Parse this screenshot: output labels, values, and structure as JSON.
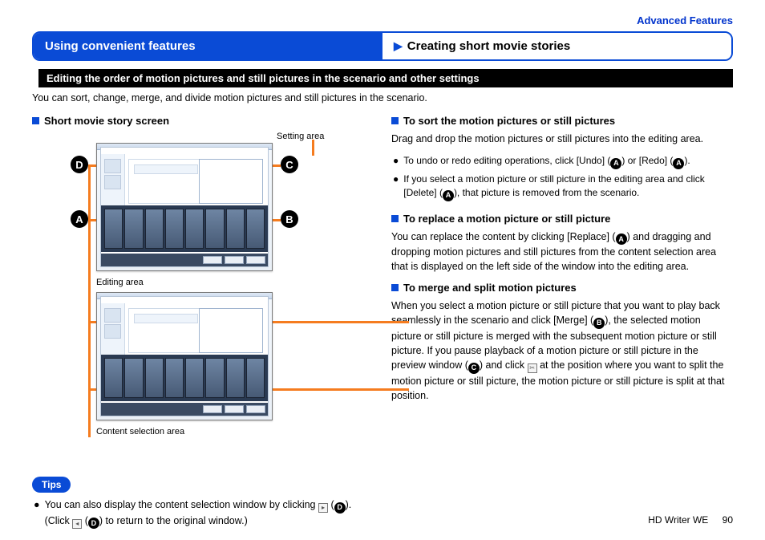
{
  "breadcrumb": "Advanced Features",
  "tabs": {
    "left": "Using convenient features",
    "right": "Creating short movie stories"
  },
  "section_bar": "Editing the order of motion pictures and still pictures in the scenario and other settings",
  "intro": "You can sort, change, merge, and divide motion pictures and still pictures in the scenario.",
  "left": {
    "heading": "Short movie story screen",
    "label_setting": "Setting area",
    "label_editing": "Editing area",
    "label_content": "Content selection area",
    "bubbles": {
      "A": "A",
      "B": "B",
      "C": "C",
      "D": "D"
    }
  },
  "right": {
    "s1": {
      "head": "To sort the motion pictures or still pictures",
      "p": "Drag and drop the motion pictures or still pictures into the editing area.",
      "b1a": "To undo or redo editing operations, click [Undo] (",
      "b1b": ") or [Redo] (",
      "b1c": ").",
      "b2a": "If you select a motion picture or still picture in the editing area and click [Delete] (",
      "b2b": "), that picture is removed from the scenario."
    },
    "s2": {
      "head": "To replace a motion picture or still picture",
      "p1": "You can replace the content by clicking [Replace] (",
      "p2": ") and dragging and dropping motion pictures and still pictures from the content selection area that is displayed on the left side of the window into the editing area."
    },
    "s3": {
      "head": "To merge and split motion pictures",
      "p1": "When you select a motion picture or still picture that you want to play back seamlessly in the scenario and click [Merge] (",
      "p2": "), the selected motion picture or still picture is merged with the subsequent motion picture or still picture. If you pause playback of a motion picture or still picture in the preview window (",
      "p3": ") and click ",
      "p4": " at the position where you want to split the motion picture or still picture, the motion picture or still picture is split at that position."
    }
  },
  "tips": {
    "badge": "Tips",
    "t1a": "You can also display the content selection window by clicking ",
    "t1b": " (",
    "t1c": ").",
    "t2a": "(Click ",
    "t2b": " (",
    "t2c": ") to return to the original window.)"
  },
  "footer": {
    "product": "HD Writer WE",
    "page": "90"
  }
}
